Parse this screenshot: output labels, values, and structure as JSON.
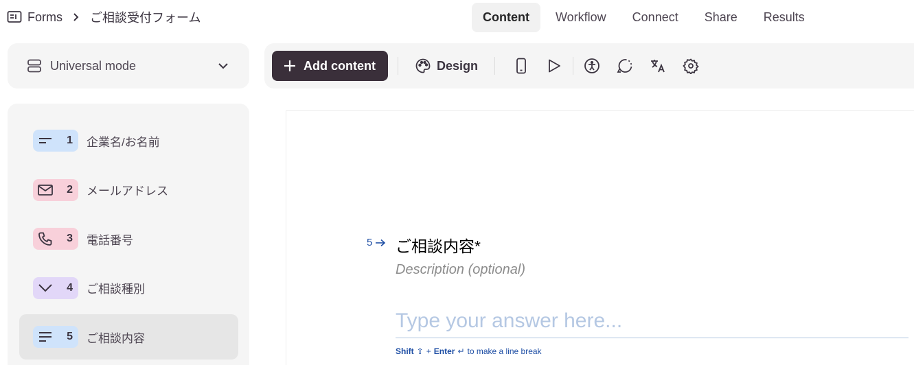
{
  "breadcrumb": {
    "root_icon": "forms-icon",
    "root": "Forms",
    "separator_icon": "chevron-right-icon",
    "current": "ご相談受付フォーム"
  },
  "nav_tabs": [
    {
      "label": "Content",
      "active": true
    },
    {
      "label": "Workflow",
      "active": false
    },
    {
      "label": "Connect",
      "active": false
    },
    {
      "label": "Share",
      "active": false
    },
    {
      "label": "Results",
      "active": false
    }
  ],
  "mode_selector": {
    "icon": "layout-rows-icon",
    "label": "Universal mode",
    "chevron_icon": "chevron-down-icon"
  },
  "toolbar": {
    "add_label": "Add content",
    "add_icon": "plus-icon",
    "design_label": "Design",
    "design_icon": "palette-icon",
    "icons": [
      "mobile-preview-icon",
      "play-icon",
      "accessibility-icon",
      "logic-icon",
      "translate-icon",
      "settings-icon"
    ]
  },
  "questions": [
    {
      "num": "1",
      "label": "企業名/お名前",
      "icon": "short-text-icon",
      "color": "#cfe3fb"
    },
    {
      "num": "2",
      "label": "メールアドレス",
      "icon": "mail-icon",
      "color": "#f8d0da"
    },
    {
      "num": "3",
      "label": "電話番号",
      "icon": "phone-icon",
      "color": "#f8d0da"
    },
    {
      "num": "4",
      "label": "ご相談種別",
      "icon": "dropdown-chevron-icon",
      "color": "#e2d7f8"
    },
    {
      "num": "5",
      "label": "ご相談内容",
      "icon": "long-text-icon",
      "color": "#cfe3fb",
      "selected": true
    }
  ],
  "canvas": {
    "question_num": "5",
    "arrow_icon": "arrow-right-icon",
    "title": "ご相談内容*",
    "description_placeholder": "Description (optional)",
    "answer_placeholder": "Type your answer here...",
    "hint": {
      "shift": "Shift",
      "shift_glyph": "⇧",
      "plus": "+",
      "enter": "Enter",
      "enter_glyph": "↵",
      "text": "to make a line break"
    }
  },
  "colors": {
    "accent_dark": "#3a2f3a",
    "question_blue": "#1f4fa5",
    "panel_bg": "#f5f5f5"
  }
}
